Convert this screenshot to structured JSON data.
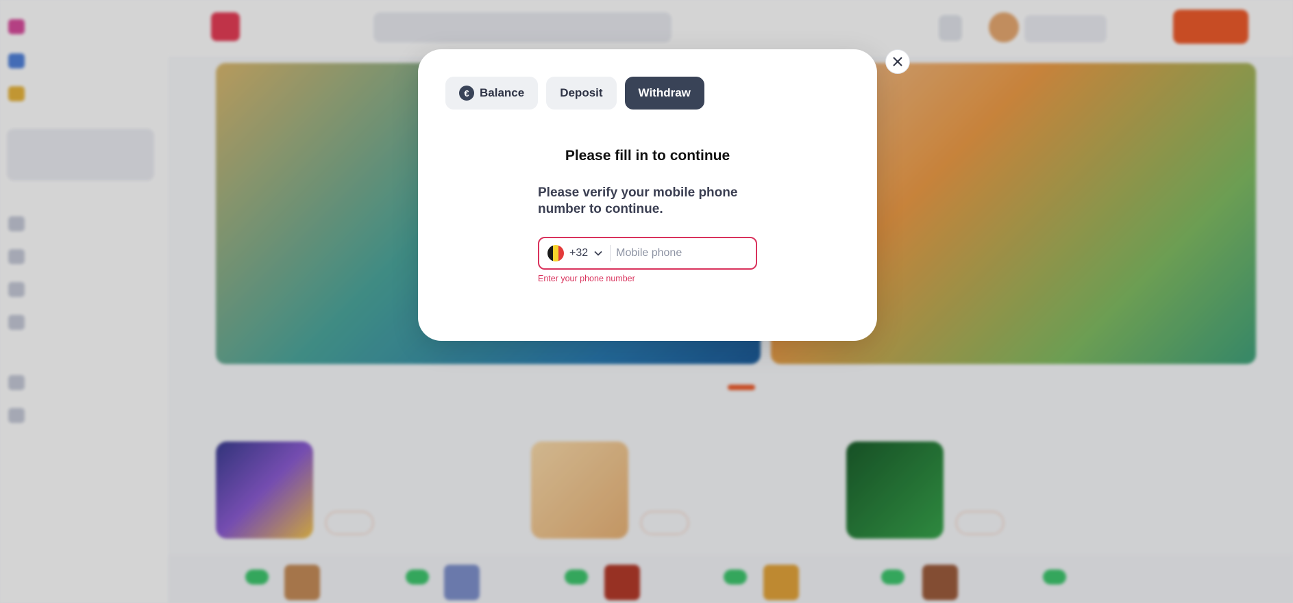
{
  "modal": {
    "tabs": [
      {
        "label": "Balance",
        "icon": "euro-icon",
        "active": false
      },
      {
        "label": "Deposit",
        "active": false
      },
      {
        "label": "Withdraw",
        "active": true
      }
    ],
    "title": "Please fill in to continue",
    "text": "Please verify your mobile phone number to continue.",
    "phone": {
      "country_code": "+32",
      "country_flag": "belgium-flag-icon",
      "placeholder": "Mobile phone",
      "value": "",
      "error": "Enter your phone number"
    },
    "close_icon": "close-icon"
  },
  "colors": {
    "active_tab": "#394357",
    "error": "#d9325c",
    "accent": "#ea5a2b"
  }
}
